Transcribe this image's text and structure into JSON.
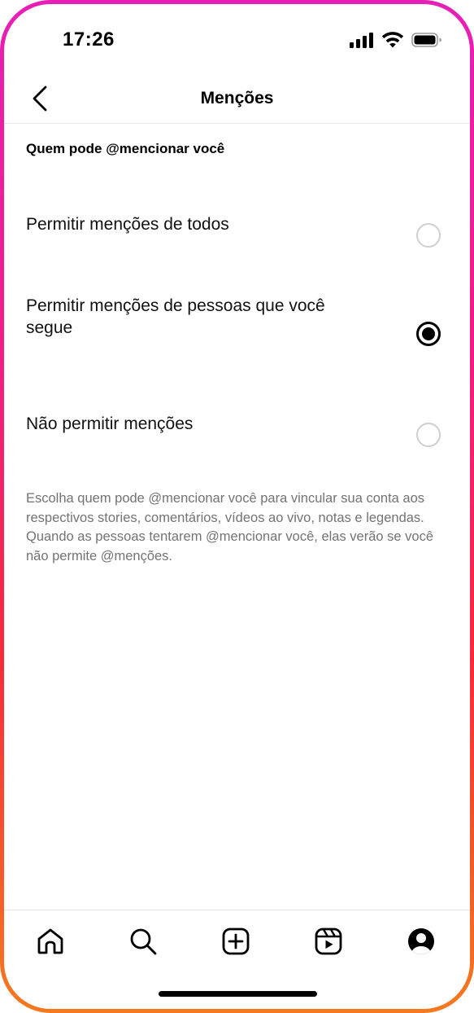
{
  "status_bar": {
    "time": "17:26",
    "icons": [
      "cellular-signal-icon",
      "wifi-icon",
      "battery-icon"
    ]
  },
  "header": {
    "title": "Menções",
    "back_icon": "chevron-left-icon"
  },
  "section": {
    "title": "Quem pode @mencionar você"
  },
  "options": [
    {
      "label": "Permitir menções de todos",
      "selected": false
    },
    {
      "label": "Permitir menções de pessoas que você segue",
      "selected": true
    },
    {
      "label": "Não permitir menções",
      "selected": false
    }
  ],
  "help_text": "Escolha quem pode @mencionar você para vincular sua conta aos respectivos stories, comentários, vídeos ao vivo, notas e legendas. Quando as pessoas tentarem @mencionar você, elas verão se você não permite @menções.",
  "tab_bar": {
    "tabs": [
      "home-icon",
      "search-icon",
      "create-icon",
      "reels-icon",
      "profile-icon"
    ]
  },
  "colors": {
    "frame_gradient": [
      "#e81fb7",
      "#f21c86",
      "#f72a3b",
      "#f6791e"
    ],
    "help_text": "#737373",
    "radio_unselected": "#cfcfcf",
    "radio_selected": "#000000"
  }
}
